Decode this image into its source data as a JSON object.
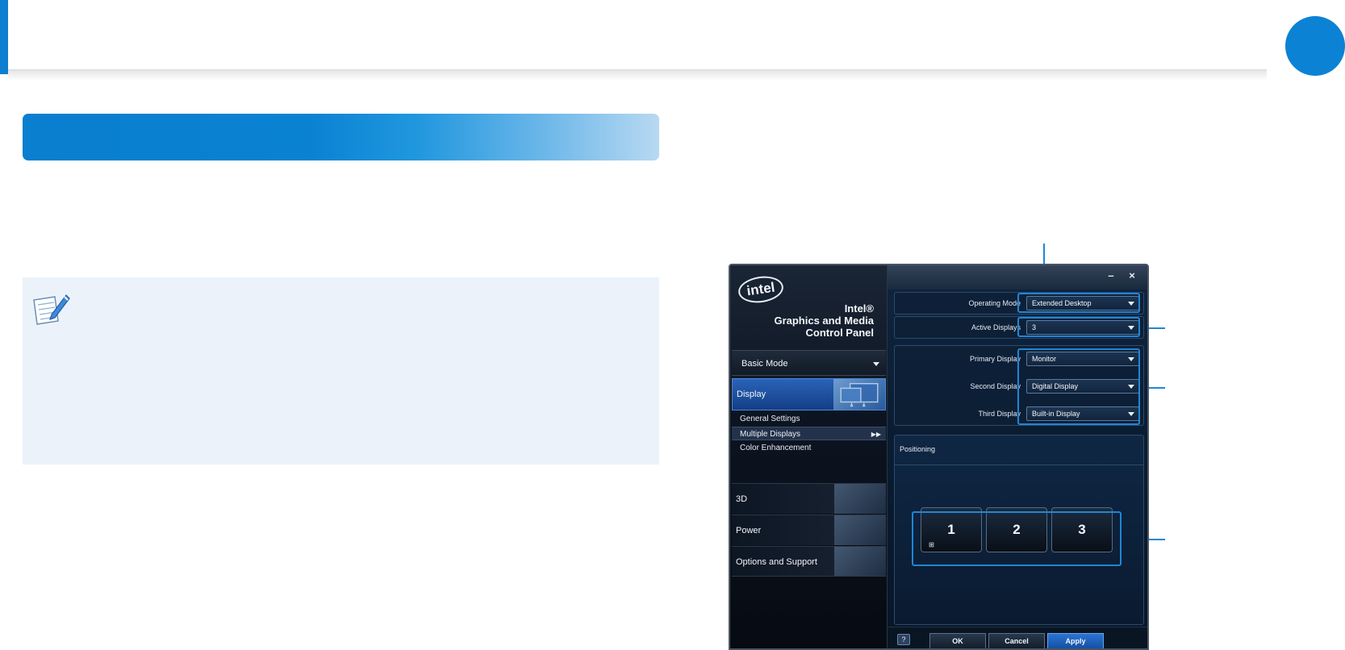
{
  "window": {
    "logo_text": "intel",
    "title_lines": [
      "Intel®",
      "Graphics and Media",
      "Control Panel"
    ],
    "controls": {
      "minimize": "–",
      "close": "×"
    },
    "mode_select": "Basic Mode",
    "categories": {
      "display": "Display",
      "threed": "3D",
      "power": "Power",
      "options": "Options and Support"
    },
    "display_subitems": [
      "General Settings",
      "Multiple Displays",
      "Color Enhancement"
    ],
    "settings": {
      "operating_mode": {
        "label": "Operating Mode",
        "value": "Extended Desktop"
      },
      "active_displays": {
        "label": "Active Displays",
        "value": "3"
      },
      "primary_display": {
        "label": "Primary Display",
        "value": "Monitor"
      },
      "second_display": {
        "label": "Second Display",
        "value": "Digital Display"
      },
      "third_display": {
        "label": "Third Display",
        "value": "Built-in Display"
      }
    },
    "positioning": {
      "title": "Positioning",
      "monitors": [
        "1",
        "2",
        "3"
      ]
    },
    "footer": {
      "help": "?",
      "ok": "OK",
      "cancel": "Cancel",
      "apply": "Apply"
    }
  },
  "colors": {
    "accent": "#0c7fd0",
    "note_bg": "#ebf2fa",
    "callout": "#1f86d6"
  }
}
